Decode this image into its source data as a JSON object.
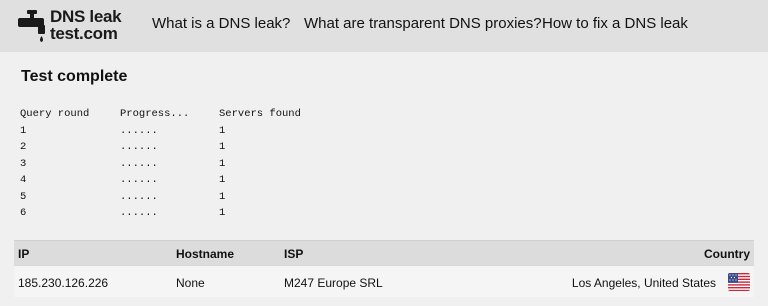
{
  "header": {
    "logo_line1": "DNS leak",
    "logo_line2": "test.com",
    "nav": [
      {
        "label": "What is a DNS leak?"
      },
      {
        "label": "What are transparent DNS proxies?"
      },
      {
        "label": "How to fix a DNS leak"
      }
    ]
  },
  "main": {
    "title": "Test complete",
    "query_table": {
      "headers": [
        "Query round",
        "Progress...",
        "Servers found"
      ],
      "rows": [
        {
          "round": "1",
          "progress": "......",
          "servers": "1"
        },
        {
          "round": "2",
          "progress": "......",
          "servers": "1"
        },
        {
          "round": "3",
          "progress": "......",
          "servers": "1"
        },
        {
          "round": "4",
          "progress": "......",
          "servers": "1"
        },
        {
          "round": "5",
          "progress": "......",
          "servers": "1"
        },
        {
          "round": "6",
          "progress": "......",
          "servers": "1"
        }
      ]
    },
    "results": {
      "headers": {
        "ip": "IP",
        "hostname": "Hostname",
        "isp": "ISP",
        "country": "Country"
      },
      "rows": [
        {
          "ip": "185.230.126.226",
          "hostname": "None",
          "isp": "M247 Europe SRL",
          "country": "Los Angeles, United States",
          "flag_icon": "us-flag-icon"
        }
      ]
    }
  },
  "colors": {
    "header_bg": "#e0e0e0",
    "page_bg": "#f0f0f0",
    "table_header_bg": "#dcdcdc"
  }
}
